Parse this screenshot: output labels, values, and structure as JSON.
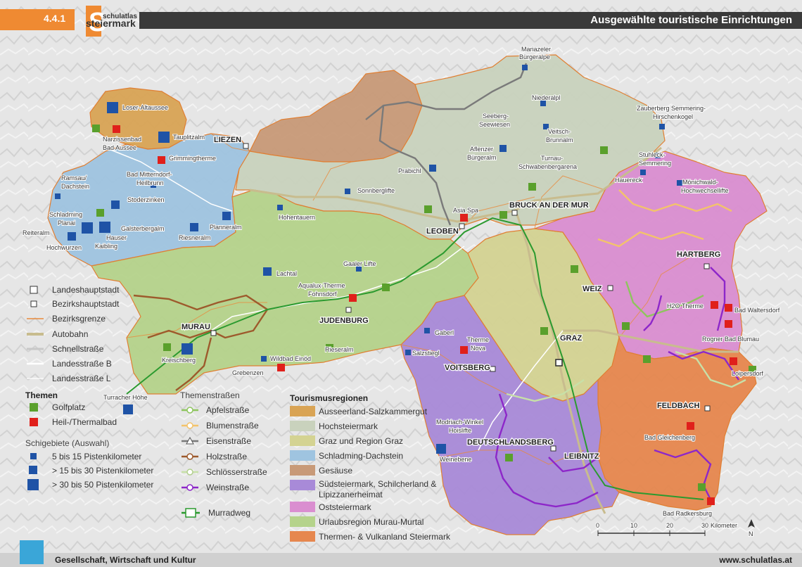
{
  "header": {
    "section_number": "4.4.1",
    "logo_text_top": "schulatlas",
    "logo_text_bottom": "steiermark",
    "logo_letter": "S",
    "title": "Ausgewählte touristische Einrichtungen"
  },
  "colors": {
    "ausseerland": "#d9a455",
    "hochsteiermark": "#c9d2bd",
    "graz": "#d4d392",
    "schladming": "#9fc4e0",
    "gesaeuse": "#c89a78",
    "suedsteiermark": "#a88ad8",
    "oststeiermark": "#da8ed0",
    "murau": "#b5d38b",
    "thermen": "#e6874e",
    "golf": "#5aa02c",
    "spa": "#e0201b",
    "ski": "#1f53a6",
    "apfel": "#8ec55e",
    "blumen": "#f3c36b",
    "eisen": "#7a7a7a",
    "holz": "#9d5a2c",
    "schloesser": "#c7e0a8",
    "wein": "#8d27c9",
    "murradweg": "#2b9a2f",
    "header_accent": "#ef8a32",
    "header_bar": "#3a3a3a"
  },
  "map_labels": {
    "district_capitals": [
      "LIEZEN",
      "BRUCK AN DER MUR",
      "LEOBEN",
      "MURAU",
      "JUDENBURG",
      "VOITSBERG",
      "DEUTSCHLANDSBERG",
      "LEIBNITZ",
      "HARTBERG",
      "WEIZ",
      "FELDBACH"
    ],
    "state_capital": "GRAZ",
    "places": [
      "Mariazeler",
      "Bürgeralpe",
      "Loser-Altaussee",
      "Narzissenbad",
      "Bad Aussee",
      "Tauplitzalm",
      "Grimmingtherme",
      "Bad Mitterndorf-",
      "Heilbrunn",
      "Ramsau/",
      "Dachstein",
      "Stoderzinken",
      "Schladming",
      "Planai",
      "Reiteralm",
      "Hochwurzen",
      "Hauser",
      "Kaibling",
      "Galsterbergalm",
      "Riesneralm",
      "Planneralm",
      "Niederalpl",
      "Seeberg-",
      "Seewiesen",
      "Veitsch-",
      "Brunnalm",
      "Aflenzer",
      "Bürgeralm",
      "Turnau-",
      "Schwabenbergarena",
      "Prabichl",
      "Sonnberglifte",
      "Asia Spa",
      "Zauberberg Semmering-",
      "Hirschenkogel",
      "Stuhleck-",
      "Semmering",
      "Hauereck",
      "Mönichwald-",
      "Hochwechsellifte",
      "Hohentauern",
      "Lachtal",
      "Gaaler Lifte",
      "Aqualux-Therme",
      "Fohnsdorf",
      "Rieseralm",
      "Gaberl",
      "Salzstiegl",
      "Therme",
      "Nova",
      "Kreischberg",
      "Grebenzen",
      "Wildbad Einöd",
      "Turracher Höhe",
      "Modriach-Winkel",
      "Hoislifte",
      "Weinebene",
      "H2O Therme",
      "Bad Waltersdorf",
      "Rogner Bad Blumau",
      "Loipersdorf",
      "Bad Gleichenberg",
      "Bad Radkersburg"
    ]
  },
  "legend": {
    "admin": [
      "Landeshauptstadt",
      "Bezirkshauptstadt",
      "Bezirksgrenze",
      "Autobahn",
      "Schnellstraße",
      "Landesstraße B",
      "Landesstraße L"
    ],
    "themen_title": "Themen",
    "themen": [
      "Golfplatz",
      "Heil-/Thermalbad"
    ],
    "ski_title": "Schigebiete (Auswahl)",
    "ski": [
      "5 bis 15 Pistenkilometer",
      "> 15 bis 30 Pistenkilometer",
      "> 30 bis 50 Pistenkilometer"
    ],
    "themenstrassen_title": "Themenstraßen",
    "themenstrassen": [
      "Apfelstraße",
      "Blumenstraße",
      "Eisenstraße",
      "Holzstraße",
      "Schlösserstraße",
      "Weinstraße"
    ],
    "murradweg": "Murradweg",
    "regions_title": "Tourismusregionen",
    "regions": [
      "Ausseerland-Salzkammergut",
      "Hochsteiermark",
      "Graz und Region Graz",
      "Schladming-Dachstein",
      "Gesäuse",
      "Südsteiermark, Schilcherland &",
      "Lipizzanerheimat",
      "Oststeiermark",
      "Urlaubsregion Murau-Murtal",
      "Thermen- & Vulkanland Steiermark"
    ]
  },
  "scale": {
    "ticks": [
      "0",
      "10",
      "20",
      "30"
    ],
    "unit": "Kilometer",
    "north": "N"
  },
  "footer": {
    "left": "Gesellschaft, Wirtschaft und Kultur",
    "right": "www.schulatlas.at"
  }
}
